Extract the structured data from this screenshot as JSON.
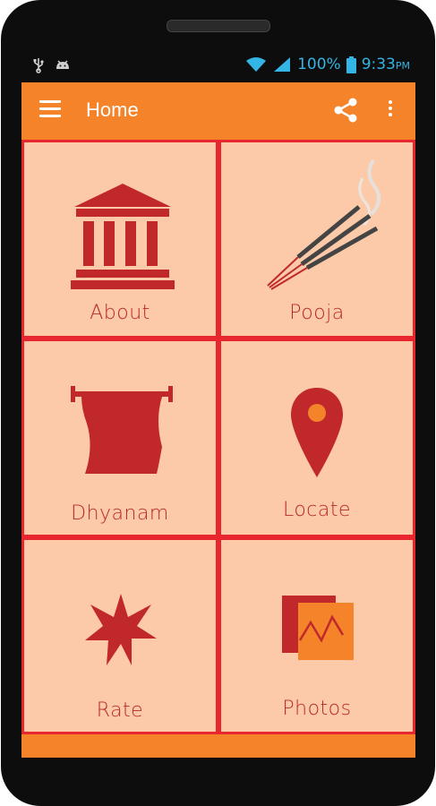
{
  "status": {
    "battery": "100%",
    "time": "9:33",
    "ampm": "PM"
  },
  "appbar": {
    "title": "Home"
  },
  "tiles": [
    {
      "label": "About",
      "icon": "temple-icon"
    },
    {
      "label": "Pooja",
      "icon": "incense-icon"
    },
    {
      "label": "Dhyanam",
      "icon": "scroll-icon"
    },
    {
      "label": "Locate",
      "icon": "location-pin-icon"
    },
    {
      "label": "Rate",
      "icon": "star-icon"
    },
    {
      "label": "Photos",
      "icon": "photos-icon"
    }
  ],
  "colors": {
    "accent": "#f5832a",
    "tile_bg": "#fccaa8",
    "grid_lines": "#e8262e",
    "icon": "#c0282c",
    "status": "#33b5e5"
  }
}
